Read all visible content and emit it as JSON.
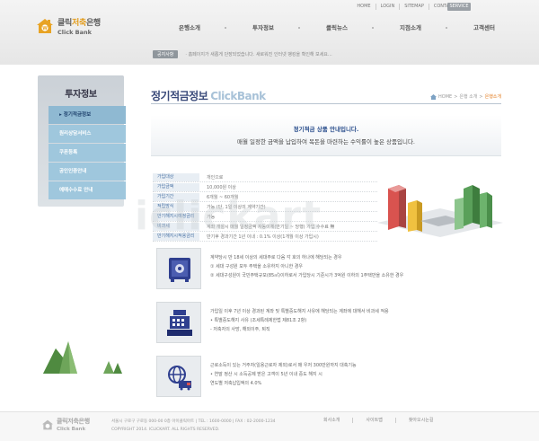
{
  "header": {
    "util_links": [
      "HOME",
      "LOGIN",
      "SITEMAP",
      "CONTACT US"
    ],
    "service_label": "SERVICE",
    "logo_ko_prefix": "클릭",
    "logo_ko_accent": "저축",
    "logo_ko_suffix": "은행",
    "logo_en": "Click Bank",
    "gnb": [
      "은행소개",
      "투자정보",
      "클릭뉴스",
      "지점소개",
      "고객센터"
    ],
    "notice_label": "공지사항",
    "notice_text": "· 홈페이지가 새롭게 단장되었습니다. 새로워진 인터넷 뱅킹을 확인해 보세요..."
  },
  "sidebar": {
    "title": "투자정보",
    "items": [
      "정기적금정보",
      "원리상담서비스",
      "쿠폰등록",
      "공인인증안내",
      "예매수수료 안내"
    ]
  },
  "main": {
    "title_ko": "정기적금정보",
    "title_en": "ClickBank",
    "breadcrumb": [
      "HOME",
      ">",
      "은행 소개",
      ">",
      "은행소개"
    ],
    "intro_line1": "정기적금 상품 안내입니다.",
    "intro_line2": "매월 일정한 금액을 납입하여 목돈을 마련하는 수익률이 높은 상품입니다.",
    "info_rows": [
      {
        "label": "가입대상",
        "value": "개인으로"
      },
      {
        "label": "가입금액",
        "value": "10,000원 이상"
      },
      {
        "label": "가입기간",
        "value": "6개월 ~ 60개월"
      },
      {
        "label": "적립방식",
        "value": "가능 (단, 1일 이상의 계약기간)"
      },
      {
        "label": "만기해지시예정금리",
        "value": "가능"
      },
      {
        "label": "비과세",
        "value": "계좌 개설시 매월 일정금액 자동이체(만기일 ~ 당행) 가입 수수료 無"
      },
      {
        "label": "만기해지시적용금리",
        "value": "만기후 경과기간 1년 이내 : 0.1% 이상(1개월 이상 가입시)"
      }
    ],
    "watermark": "iclickart",
    "features": [
      {
        "icon": "safe-icon",
        "lines": [
          "계약당시 만 18세 이상의 세대주로 다음 각 호의 하나에 해당되는 경우",
          "① 세대 구성원 모두 주택을 소유하지 아니한 경우",
          "② 세대구성원이 국민주택규모(85㎡)이하로서 가입당시 기준시가 3억원 이하의 1주택만을 소유한 경우"
        ]
      },
      {
        "icon": "cash-register-icon",
        "lines": [
          "가입일 이후 7년 이상 경과된 계좌 및 특별중도해지 사유에 해당되는 계좌에 대해서 비과세 적용",
          "• 특별중도해지 사유 (조세특례제한법 제81조 2항)",
          "- 저축자의 사망, 해외이주, 퇴직"
        ]
      },
      {
        "icon": "globe-truck-icon",
        "lines": [
          "근로소득이 있는 거주자(일용근로자 제외)로서 매 우저 300만원까지 대축기능",
          "• 연말 정산 시 소득공제 받은 고객이 5년 이내 중도 해지 시",
          "연도별 저축납입액의 4.0%"
        ]
      }
    ]
  },
  "footer": {
    "logo_ko": "클릭저축은행",
    "logo_en": "Click Bank",
    "address_line": "서울시 구로구 구로동 000-00 0층 아이클릭아트   |   TEL : 1600-0000   |   FAX : 02-2000-1234",
    "copyright": "COPYRIGHT 2014. ICLICKART. ALL RIGHTS RESERVED.",
    "links": [
      "회사소개",
      "사이트맵",
      "찾아오시는길"
    ]
  },
  "colors": {
    "title_blue": "#3a4a7a",
    "sidebar_item": "#9fc7dd",
    "accent_orange": "#e29a17"
  }
}
